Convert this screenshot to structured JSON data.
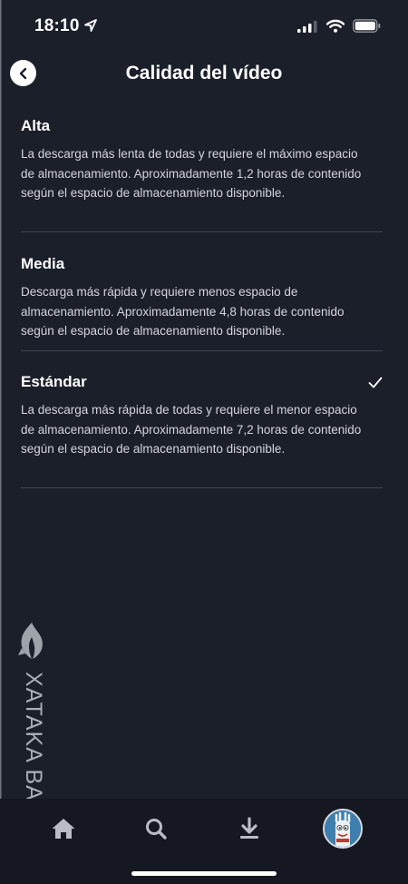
{
  "status_bar": {
    "time": "18:10",
    "icons": [
      "location-arrow-icon",
      "cellular-signal-icon",
      "wifi-icon",
      "battery-icon"
    ]
  },
  "header": {
    "title": "Calidad del vídeo",
    "back_icon": "chevron-left-icon"
  },
  "options": [
    {
      "title": "Alta",
      "description": "La descarga más lenta de todas y requiere el máximo espacio de almacenamiento. Aproximadamente 1,2 horas de contenido según el espacio de almacenamiento disponible.",
      "selected": false
    },
    {
      "title": "Media",
      "description": "Descarga más rápida y requiere menos espacio de almacenamiento. Aproximadamente 4,8 horas de contenido según el espacio de almacenamiento disponible.",
      "selected": false
    },
    {
      "title": "Estándar",
      "description": "La descarga más rápida de todas y requiere el menor espacio de almacenamiento. Aproximadamente 7,2 horas de contenido según el espacio de almacenamiento disponible.",
      "selected": true
    }
  ],
  "watermark": {
    "text": "XATAKA BASICS"
  },
  "tab_bar": {
    "tabs": [
      "home-icon",
      "search-icon",
      "download-icon",
      "profile-avatar"
    ]
  },
  "colors": {
    "background": "#1b1f2a",
    "tab_bar": "#151821",
    "divider": "#414654",
    "text": "#ffffff",
    "description": "#d2d5dc"
  }
}
